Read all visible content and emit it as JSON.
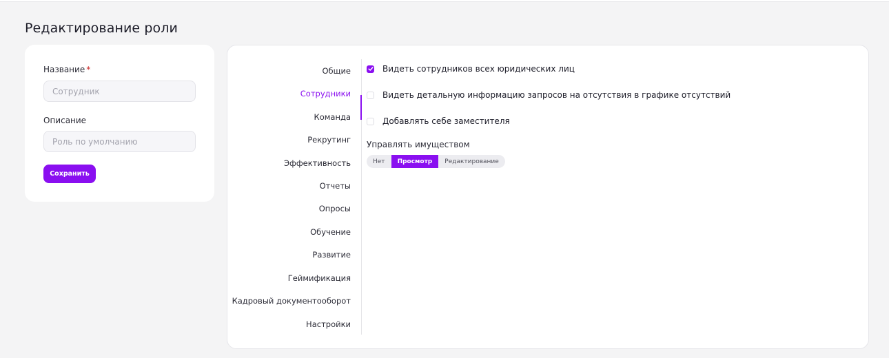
{
  "page": {
    "title": "Редактирование роли"
  },
  "form": {
    "name_label": "Название",
    "required_mark": "*",
    "name_placeholder": "Сотрудник",
    "description_label": "Описание",
    "description_placeholder": "Роль по умолчанию",
    "save_label": "Сохранить"
  },
  "sections": [
    {
      "label": "Общие",
      "active": false
    },
    {
      "label": "Сотрудники",
      "active": true
    },
    {
      "label": "Команда",
      "active": false
    },
    {
      "label": "Рекрутинг",
      "active": false
    },
    {
      "label": "Эффективность",
      "active": false
    },
    {
      "label": "Отчеты",
      "active": false
    },
    {
      "label": "Опросы",
      "active": false
    },
    {
      "label": "Обучение",
      "active": false
    },
    {
      "label": "Развитие",
      "active": false
    },
    {
      "label": "Геймификация",
      "active": false
    },
    {
      "label": "Кадровый документооборот",
      "active": false
    },
    {
      "label": "Настройки",
      "active": false
    }
  ],
  "permissions": [
    {
      "label": "Видеть сотрудников всех юридических лиц",
      "checked": true
    },
    {
      "label": "Видеть детальную информацию запросов на отсутствия в графике отсутствий",
      "checked": false
    },
    {
      "label": "Добавлять себе заместителя",
      "checked": false
    }
  ],
  "property_access": {
    "label": "Управлять имуществом",
    "options": [
      "Нет",
      "Просмотр",
      "Редактирование"
    ],
    "selected": "Просмотр"
  },
  "colors": {
    "accent": "#8a0ff0",
    "background": "#f4f4f5",
    "card": "#ffffff"
  }
}
